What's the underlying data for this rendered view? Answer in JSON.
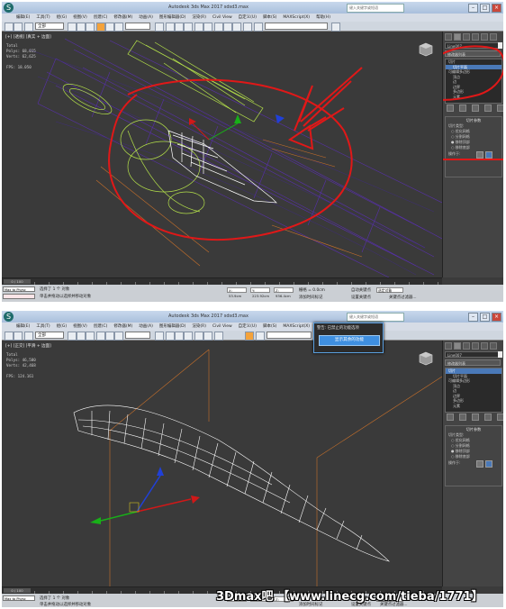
{
  "colors": {
    "accent_blue": "#4a79b8",
    "annotation_red": "#e01818",
    "wire_purple": "#5b2fb8",
    "wire_green": "#b4e04a",
    "wire_white": "#ffffff"
  },
  "screen1": {
    "title": "Autodesk 3ds Max 2017   sdsd3.max",
    "search_placeholder": "键入关键字或短语",
    "menu": [
      "编辑(E)",
      "工具(T)",
      "组(G)",
      "视图(V)",
      "创建(C)",
      "修改器(M)",
      "动画(A)",
      "图形编辑器(D)",
      "渲染(R)",
      "Civil View",
      "自定义(U)",
      "脚本(S)",
      "MAXScript(X)",
      "帮助(H)"
    ],
    "selection_filter": "全部",
    "viewport_label": "[+] [透视] [真实 + 边面]",
    "stats": {
      "total_label": "Total",
      "polys": "Polys: 68,015",
      "verts": "Verts: 62,625",
      "fps": "FPS:   18.050"
    },
    "object_name": "Line007",
    "modifier_list_label": "修改器列表",
    "modifier_stack": [
      {
        "label": "切片",
        "selected": false,
        "top": true
      },
      {
        "label": "切片平面",
        "selected": true,
        "top": false
      },
      {
        "label": "可编辑多边形",
        "selected": false,
        "top": true
      },
      {
        "label": "顶点",
        "selected": false,
        "top": false
      },
      {
        "label": "边",
        "selected": false,
        "top": false
      },
      {
        "label": "边界",
        "selected": false,
        "top": false
      },
      {
        "label": "多边形",
        "selected": false,
        "top": false
      },
      {
        "label": "元素",
        "selected": false,
        "top": false
      }
    ],
    "rollout_title": "切片参数",
    "slice_type_label": "切片类型:",
    "slice_types": [
      {
        "label": "优化网格",
        "on": false
      },
      {
        "label": "分割网格",
        "on": false
      },
      {
        "label": "移除顶部",
        "on": true
      },
      {
        "label": "移除底部",
        "on": false
      }
    ],
    "operate_label": "操作于:",
    "time_slider": "0 / 100",
    "maxscript": "Max to Physc",
    "status_line1": "选择了 1 个 对象",
    "status_line2": "单击并拖动以选择并移动对象",
    "coords": [
      "X: 53.9cm",
      "Y: 223.92cm",
      "Z: 936.4cm"
    ],
    "grid": "栅格 = 0.0cm",
    "add_time_tag": "添加时间标记",
    "autokey": "自动关键点",
    "set_key": "设置关键点",
    "selected_label": "选定对象",
    "key_filters": "关键点过滤器..."
  },
  "screen2": {
    "title": "Autodesk 3ds Max 2017   sdsd3.max",
    "search_placeholder": "键入关键字或短语",
    "menu": [
      "编辑(E)",
      "工具(T)",
      "组(G)",
      "视图(V)",
      "创建(C)",
      "修改器(M)",
      "动画(A)",
      "图形编辑器(D)",
      "渲染(R)",
      "Civil View",
      "自定义(U)",
      "脚本(S)",
      "MAXScript(X)",
      "帮助(H)"
    ],
    "selection_filter": "全部",
    "viewport_label": "[+] [正交] [平滑 + 边面]",
    "stats": {
      "total_label": "Total",
      "polys": "Polys: 46,580",
      "verts": "Verts: 42,468",
      "fps": "FPS:  124.161"
    },
    "popup_title": "警告: 已禁止的功能选项",
    "popup_button": "显示其余的功能",
    "object_name": "Line007",
    "modifier_list_label": "修改器列表",
    "modifier_stack": [
      {
        "label": "切片",
        "selected": true,
        "top": true
      },
      {
        "label": "切片平面",
        "selected": false,
        "top": false
      },
      {
        "label": "可编辑多边形",
        "selected": false,
        "top": true
      },
      {
        "label": "顶点",
        "selected": false,
        "top": false
      },
      {
        "label": "边",
        "selected": false,
        "top": false
      },
      {
        "label": "边界",
        "selected": false,
        "top": false
      },
      {
        "label": "多边形",
        "selected": false,
        "top": false
      },
      {
        "label": "元素",
        "selected": false,
        "top": false
      }
    ],
    "rollout_title": "切片参数",
    "slice_type_label": "切片类型:",
    "slice_types": [
      {
        "label": "优化网格",
        "on": false
      },
      {
        "label": "分割网格",
        "on": false
      },
      {
        "label": "移除顶部",
        "on": true
      },
      {
        "label": "移除底部",
        "on": false
      }
    ],
    "operate_label": "操作于:",
    "time_slider": "0 / 100",
    "maxscript": "Max to Physc",
    "status_line1": "选择了 1 个 对象",
    "status_line2": "单击并拖动以选择并移动对象",
    "coords": [
      "X:",
      "Y:",
      "Z:"
    ],
    "grid": "栅格 = 10.0cm",
    "add_time_tag": "添加时间标记",
    "autokey": "自动关键点",
    "set_key": "设置关键点",
    "selected_label": "选定对象",
    "key_filters": "关键点过滤器..."
  },
  "watermark": "3Dmax吧  【www.linecg.com/tieba/1771】"
}
